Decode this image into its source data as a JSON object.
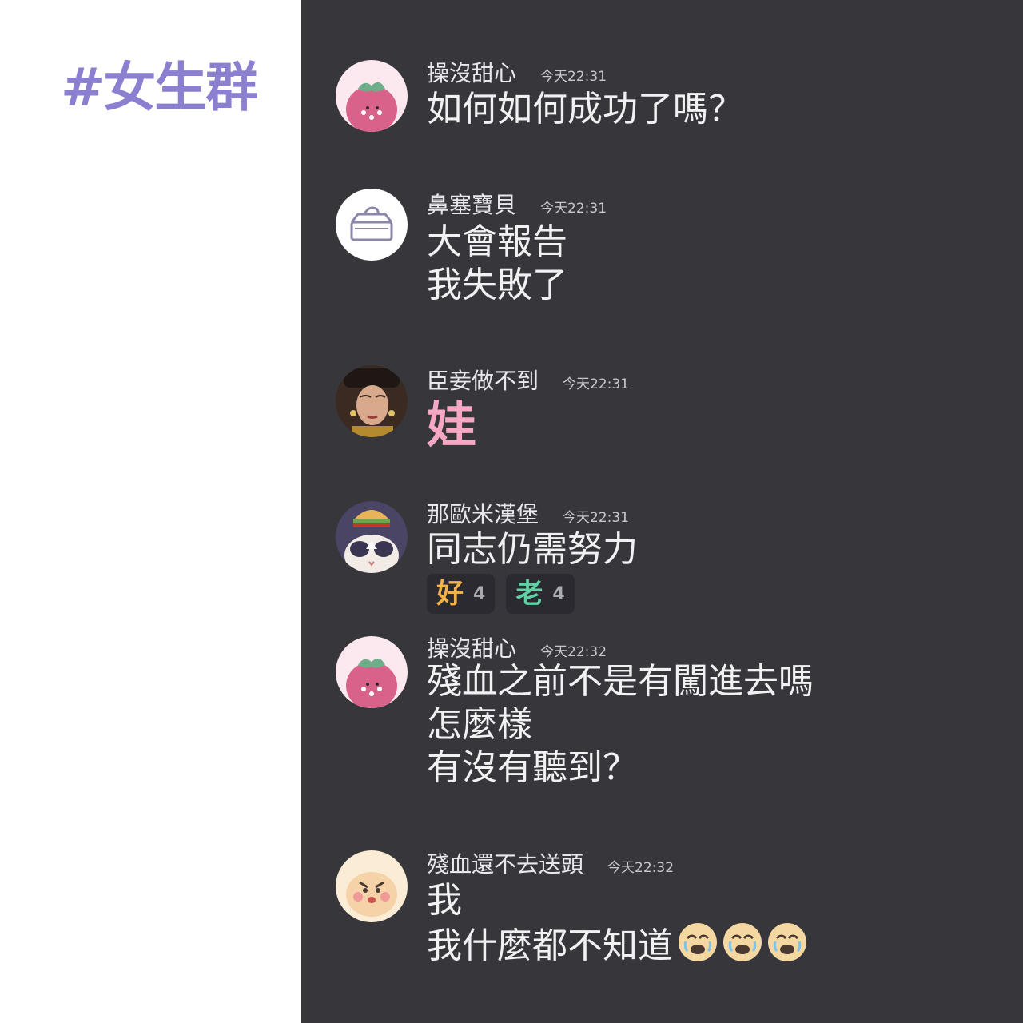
{
  "header": {
    "hashtag": "#女生群"
  },
  "colors": {
    "left_bg": "#ffffff",
    "chat_bg": "#36363b",
    "hashtag": "#8b7fd0",
    "pink_text": "#f6a7c3",
    "reaction_good": "#f2b24b",
    "reaction_old": "#5fd1a5"
  },
  "messages": [
    {
      "avatar_icon": "strawberry-avatar",
      "username": "操沒甜心",
      "time": "今天22:31",
      "lines": [
        "如何如何成功了嗎？"
      ]
    },
    {
      "avatar_icon": "tissue-box-avatar",
      "username": "鼻塞寶貝",
      "time": "今天22:31",
      "lines": [
        "大會報告",
        "我失敗了"
      ]
    },
    {
      "avatar_icon": "empress-portrait-avatar",
      "username": "臣妾做不到",
      "time": "今天22:31",
      "big_text": "娃"
    },
    {
      "avatar_icon": "burger-cat-avatar",
      "username": "那歐米漢堡",
      "time": "今天22:31",
      "lines": [
        "同志仍需努力"
      ],
      "reactions": [
        {
          "glyph": "好",
          "count": "4",
          "color": "#f2b24b"
        },
        {
          "glyph": "老",
          "count": "4",
          "color": "#5fd1a5"
        }
      ]
    },
    {
      "avatar_icon": "strawberry-avatar",
      "username": "操沒甜心",
      "time": "今天22:32",
      "lines": [
        "殘血之前不是有闖進去嗎",
        "怎麼樣",
        "有沒有聽到？"
      ]
    },
    {
      "avatar_icon": "angry-bun-avatar",
      "username": "殘血還不去送頭",
      "time": "今天22:32",
      "lines": [
        "我",
        "我什麼都不知道"
      ],
      "trailing_emoji": [
        "crying-face-emoji",
        "crying-face-emoji",
        "crying-face-emoji"
      ]
    }
  ]
}
